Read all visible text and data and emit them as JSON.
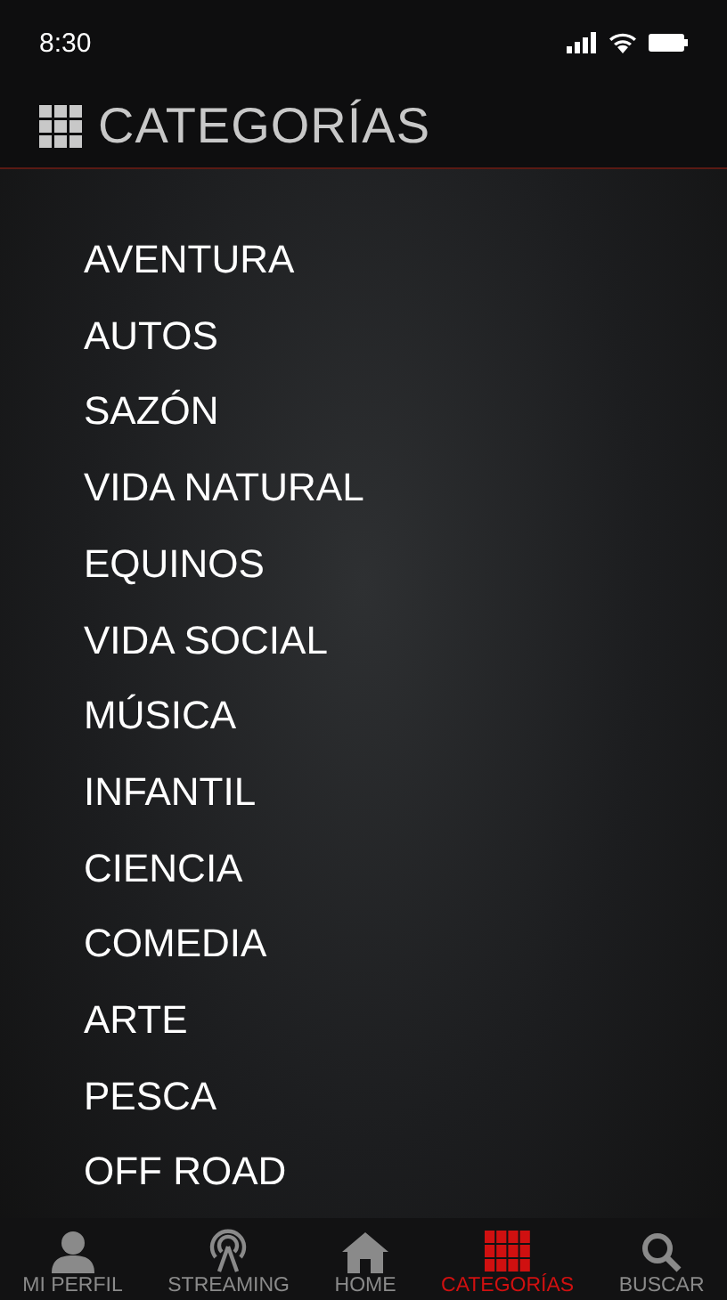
{
  "status_bar": {
    "time": "8:30"
  },
  "header": {
    "title": "CATEGORÍAS"
  },
  "categories": [
    "AVENTURA",
    "AUTOS",
    "SAZÓN",
    "VIDA NATURAL",
    "EQUINOS",
    "VIDA SOCIAL",
    "MÚSICA",
    "INFANTIL",
    "CIENCIA",
    "COMEDIA",
    "ARTE",
    "PESCA",
    "OFF ROAD"
  ],
  "tabs": [
    {
      "kind": "profile",
      "label": "MI PERFIL",
      "selected": false
    },
    {
      "kind": "streaming",
      "label": "STREAMING",
      "selected": false
    },
    {
      "kind": "home",
      "label": "HOME",
      "selected": false
    },
    {
      "kind": "grid",
      "label": "CATEGORÍAS",
      "selected": true
    },
    {
      "kind": "search",
      "label": "BUSCAR",
      "selected": false
    }
  ]
}
